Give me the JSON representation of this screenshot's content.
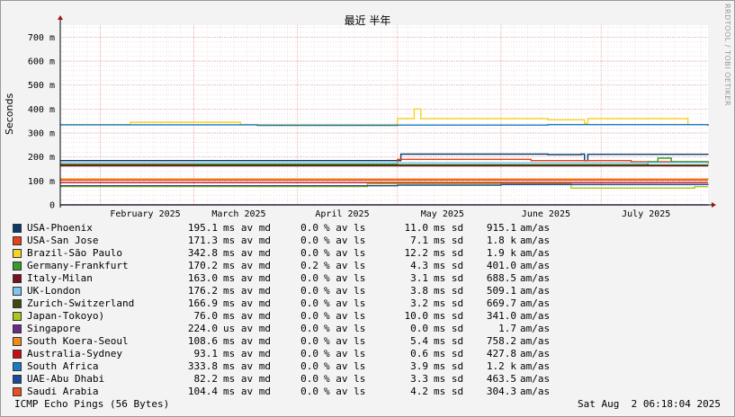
{
  "title": "最近 半年",
  "watermark": "RRDTOOL / TOBI OETIKER",
  "footer": {
    "left": "ICMP Echo Pings (56 Bytes)",
    "right": "Sat Aug  2 06:18:04 2025"
  },
  "legend": [
    {
      "name": "USA-Phoenix",
      "avg": "195.1",
      "avg_unit": "ms av md",
      "loss": "0.0",
      "loss_unit": "% av ls",
      "sd": "11.0",
      "sd_unit": "ms sd",
      "amsd": "915.1",
      "amsd_unit": "am/as",
      "color": "#0a3b6b"
    },
    {
      "name": "USA-San Jose",
      "avg": "171.3",
      "avg_unit": "ms av md",
      "loss": "0.0",
      "loss_unit": "% av ls",
      "sd": "7.1",
      "sd_unit": "ms sd",
      "amsd": "1.8 k",
      "amsd_unit": "am/as",
      "color": "#e8411a"
    },
    {
      "name": "Brazil-São Paulo",
      "avg": "342.8",
      "avg_unit": "ms av md",
      "loss": "0.0",
      "loss_unit": "% av ls",
      "sd": "12.2",
      "sd_unit": "ms sd",
      "amsd": "1.9 k",
      "amsd_unit": "am/as",
      "color": "#f5d327"
    },
    {
      "name": "Germany-Frankfurt",
      "avg": "170.2",
      "avg_unit": "ms av md",
      "loss": "0.2",
      "loss_unit": "% av ls",
      "sd": "4.3",
      "sd_unit": "ms sd",
      "amsd": "401.0",
      "amsd_unit": "am/as",
      "color": "#3a9a2a"
    },
    {
      "name": "Italy-Milan",
      "avg": "163.0",
      "avg_unit": "ms av md",
      "loss": "0.0",
      "loss_unit": "% av ls",
      "sd": "3.1",
      "sd_unit": "ms sd",
      "amsd": "688.5",
      "amsd_unit": "am/as",
      "color": "#7a1020"
    },
    {
      "name": "UK-London",
      "avg": "176.2",
      "avg_unit": "ms av md",
      "loss": "0.0",
      "loss_unit": "% av ls",
      "sd": "3.8",
      "sd_unit": "ms sd",
      "amsd": "509.1",
      "amsd_unit": "am/as",
      "color": "#7ec8f0"
    },
    {
      "name": "Zurich-Switzerland",
      "avg": "166.9",
      "avg_unit": "ms av md",
      "loss": "0.0",
      "loss_unit": "% av ls",
      "sd": "3.2",
      "sd_unit": "ms sd",
      "amsd": "669.7",
      "amsd_unit": "am/as",
      "color": "#3d4a10"
    },
    {
      "name": "Japan-Tokoyo)",
      "avg": "76.0",
      "avg_unit": "ms av md",
      "loss": "0.0",
      "loss_unit": "% av ls",
      "sd": "10.0",
      "sd_unit": "ms sd",
      "amsd": "341.0",
      "amsd_unit": "am/as",
      "color": "#a8c81a"
    },
    {
      "name": "Singapore",
      "avg": "224.0",
      "avg_unit": "us av md",
      "loss": "0.0",
      "loss_unit": "% av ls",
      "sd": "0.0",
      "sd_unit": "ms sd",
      "amsd": "1.7",
      "amsd_unit": "am/as",
      "color": "#6a2a8a"
    },
    {
      "name": "South Koera-Seoul",
      "avg": "108.6",
      "avg_unit": "ms av md",
      "loss": "0.0",
      "loss_unit": "% av ls",
      "sd": "5.4",
      "sd_unit": "ms sd",
      "amsd": "758.2",
      "amsd_unit": "am/as",
      "color": "#f08a1a"
    },
    {
      "name": "Australia-Sydney",
      "avg": "93.1",
      "avg_unit": "ms av md",
      "loss": "0.0",
      "loss_unit": "% av ls",
      "sd": "0.6",
      "sd_unit": "ms sd",
      "amsd": "427.8",
      "amsd_unit": "am/as",
      "color": "#c81010"
    },
    {
      "name": "South Africa",
      "avg": "333.8",
      "avg_unit": "ms av md",
      "loss": "0.0",
      "loss_unit": "% av ls",
      "sd": "3.9",
      "sd_unit": "ms sd",
      "amsd": "1.2 k",
      "amsd_unit": "am/as",
      "color": "#1a7ac8"
    },
    {
      "name": "UAE-Abu Dhabi",
      "avg": "82.2",
      "avg_unit": "ms av md",
      "loss": "0.0",
      "loss_unit": "% av ls",
      "sd": "3.3",
      "sd_unit": "ms sd",
      "amsd": "463.5",
      "amsd_unit": "am/as",
      "color": "#1a4a9a"
    },
    {
      "name": "Saudi Arabia",
      "avg": "104.4",
      "avg_unit": "ms av md",
      "loss": "0.0",
      "loss_unit": "% av ls",
      "sd": "4.2",
      "sd_unit": "ms sd",
      "amsd": "304.3",
      "amsd_unit": "am/as",
      "color": "#e85020"
    }
  ],
  "chart_data": {
    "type": "line",
    "title": "最近 半年",
    "ylabel": "Seconds",
    "xlabel": "",
    "y_unit": "seconds",
    "ylim": [
      0,
      0.75
    ],
    "y_ticks": [
      {
        "value": 0,
        "label": "0"
      },
      {
        "value": 0.1,
        "label": "100 m"
      },
      {
        "value": 0.2,
        "label": "200 m"
      },
      {
        "value": 0.3,
        "label": "300 m"
      },
      {
        "value": 0.4,
        "label": "400 m"
      },
      {
        "value": 0.5,
        "label": "500 m"
      },
      {
        "value": 0.6,
        "label": "600 m"
      },
      {
        "value": 0.7,
        "label": "700 m"
      }
    ],
    "xlim": [
      "2025-01-20",
      "2025-08-02"
    ],
    "x_ticks": [
      {
        "date": "2025-02-01",
        "label": "February 2025"
      },
      {
        "date": "2025-03-01",
        "label": "March 2025"
      },
      {
        "date": "2025-04-01",
        "label": "April 2025"
      },
      {
        "date": "2025-05-01",
        "label": "May 2025"
      },
      {
        "date": "2025-06-01",
        "label": "June 2025"
      },
      {
        "date": "2025-07-01",
        "label": "July 2025"
      }
    ],
    "grid": true,
    "legend_position": "bottom",
    "series": [
      {
        "name": "USA-Phoenix",
        "color": "#0a3b6b",
        "points": [
          [
            "2025-01-20",
            0.185
          ],
          [
            "2025-05-01",
            0.185
          ],
          [
            "2025-05-02",
            0.212
          ],
          [
            "2025-06-15",
            0.21
          ],
          [
            "2025-06-25",
            0.212
          ],
          [
            "2025-06-26",
            0.185
          ],
          [
            "2025-06-27",
            0.211
          ],
          [
            "2025-08-02",
            0.21
          ]
        ]
      },
      {
        "name": "USA-San Jose",
        "color": "#e8411a",
        "points": [
          [
            "2025-01-20",
            0.17
          ],
          [
            "2025-04-15",
            0.17
          ],
          [
            "2025-05-01",
            0.19
          ],
          [
            "2025-06-10",
            0.185
          ],
          [
            "2025-07-10",
            0.18
          ],
          [
            "2025-08-02",
            0.172
          ]
        ]
      },
      {
        "name": "Brazil-São Paulo",
        "color": "#f5d327",
        "points": [
          [
            "2025-01-20",
            0.335
          ],
          [
            "2025-02-10",
            0.345
          ],
          [
            "2025-03-15",
            0.335
          ],
          [
            "2025-04-25",
            0.335
          ],
          [
            "2025-05-01",
            0.36
          ],
          [
            "2025-05-06",
            0.4
          ],
          [
            "2025-05-08",
            0.36
          ],
          [
            "2025-06-15",
            0.355
          ],
          [
            "2025-06-26",
            0.34
          ],
          [
            "2025-06-27",
            0.36
          ],
          [
            "2025-07-25",
            0.36
          ],
          [
            "2025-07-27",
            0.335
          ],
          [
            "2025-08-02",
            0.335
          ]
        ]
      },
      {
        "name": "Germany-Frankfurt",
        "color": "#3a9a2a",
        "points": [
          [
            "2025-01-20",
            0.168
          ],
          [
            "2025-03-01",
            0.17
          ],
          [
            "2025-05-01",
            0.168
          ],
          [
            "2025-07-15",
            0.18
          ],
          [
            "2025-07-18",
            0.195
          ],
          [
            "2025-07-22",
            0.18
          ],
          [
            "2025-08-02",
            0.175
          ]
        ]
      },
      {
        "name": "Italy-Milan",
        "color": "#7a1020",
        "points": [
          [
            "2025-01-20",
            0.163
          ],
          [
            "2025-08-02",
            0.163
          ]
        ]
      },
      {
        "name": "UK-London",
        "color": "#7ec8f0",
        "points": [
          [
            "2025-01-20",
            0.176
          ],
          [
            "2025-08-02",
            0.176
          ]
        ]
      },
      {
        "name": "Zurich-Switzerland",
        "color": "#3d4a10",
        "points": [
          [
            "2025-01-20",
            0.166
          ],
          [
            "2025-08-02",
            0.168
          ]
        ]
      },
      {
        "name": "Japan-Tokoyo)",
        "color": "#a8c81a",
        "points": [
          [
            "2025-01-20",
            0.076
          ],
          [
            "2025-04-20",
            0.076
          ],
          [
            "2025-04-22",
            0.088
          ],
          [
            "2025-06-20",
            0.088
          ],
          [
            "2025-06-22",
            0.07
          ],
          [
            "2025-07-28",
            0.07
          ],
          [
            "2025-07-29",
            0.076
          ],
          [
            "2025-08-02",
            0.076
          ]
        ]
      },
      {
        "name": "Singapore",
        "color": "#6a2a8a",
        "points": [
          [
            "2025-01-20",
            0.0002
          ],
          [
            "2025-08-02",
            0.0002
          ]
        ]
      },
      {
        "name": "South Koera-Seoul",
        "color": "#f08a1a",
        "points": [
          [
            "2025-01-20",
            0.108
          ],
          [
            "2025-08-02",
            0.11
          ]
        ]
      },
      {
        "name": "Australia-Sydney",
        "color": "#c81010",
        "points": [
          [
            "2025-01-20",
            0.093
          ],
          [
            "2025-08-02",
            0.093
          ]
        ]
      },
      {
        "name": "South Africa",
        "color": "#1a7ac8",
        "points": [
          [
            "2025-01-20",
            0.334
          ],
          [
            "2025-03-20",
            0.332
          ],
          [
            "2025-05-01",
            0.333
          ],
          [
            "2025-06-15",
            0.335
          ],
          [
            "2025-08-02",
            0.33
          ]
        ]
      },
      {
        "name": "UAE-Abu Dhabi",
        "color": "#1a4a9a",
        "points": [
          [
            "2025-01-20",
            0.08
          ],
          [
            "2025-05-01",
            0.082
          ],
          [
            "2025-06-01",
            0.085
          ],
          [
            "2025-08-02",
            0.083
          ]
        ]
      },
      {
        "name": "Saudi Arabia",
        "color": "#e85020",
        "points": [
          [
            "2025-01-20",
            0.104
          ],
          [
            "2025-08-02",
            0.104
          ]
        ]
      }
    ]
  }
}
